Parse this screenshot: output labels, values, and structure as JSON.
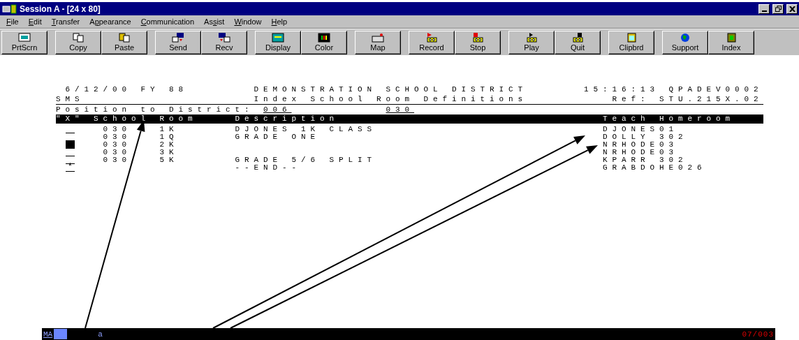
{
  "window": {
    "title": "Session A - [24 x 80]"
  },
  "menu": [
    {
      "key": "F",
      "post": "ile"
    },
    {
      "key": "E",
      "post": "dit"
    },
    {
      "key": "T",
      "post": "ransfer"
    },
    {
      "pre": "A",
      "key": "p",
      "post": "pearance"
    },
    {
      "key": "C",
      "post": "ommunication"
    },
    {
      "pre": "As",
      "key": "s",
      "post": "ist"
    },
    {
      "key": "W",
      "post": "indow"
    },
    {
      "key": "H",
      "post": "elp"
    }
  ],
  "toolbar": [
    [
      {
        "label": "PrtScrn",
        "kind": "printscreen"
      }
    ],
    [
      {
        "label": "Copy",
        "kind": "copy"
      },
      {
        "label": "Paste",
        "kind": "paste"
      }
    ],
    [
      {
        "label": "Send",
        "kind": "send"
      },
      {
        "label": "Recv",
        "kind": "receive"
      }
    ],
    [
      {
        "label": "Display",
        "kind": "display"
      },
      {
        "label": "Color",
        "kind": "color"
      }
    ],
    [
      {
        "label": "Map",
        "kind": "map"
      }
    ],
    [
      {
        "label": "Record",
        "kind": "record"
      },
      {
        "label": "Stop",
        "kind": "stop"
      }
    ],
    [
      {
        "label": "Play",
        "kind": "play"
      },
      {
        "label": "Quit",
        "kind": "quit"
      }
    ],
    [
      {
        "label": "Clipbrd",
        "kind": "clipboard"
      }
    ],
    [
      {
        "label": "Support",
        "kind": "globe"
      },
      {
        "label": "Index",
        "kind": "book"
      }
    ]
  ],
  "terminal": {
    "header": {
      "date": "6/12/00",
      "fiscal_year": "FY 88",
      "title": "DEMONSTRATION SCHOOL DISTRICT",
      "time_and_device": "15:16:13 QPADEV0002",
      "system": "SMS",
      "screen_title": "Index School Room Definitions",
      "reference": "Ref: STU.215X.02"
    },
    "position": {
      "label": "Position to District:",
      "district": "006",
      "school": "030"
    },
    "columns": [
      "\"X\"",
      "School",
      "Room",
      "Description",
      "Teach",
      "Homeroom"
    ],
    "rows": [
      {
        "cursor": false,
        "school": "030",
        "room": "1K",
        "description": "DJONES 1K CLASS",
        "teacher": "DJONES01"
      },
      {
        "cursor": false,
        "school": "030",
        "room": "1Q",
        "description": "GRADE ONE",
        "teacher": "DOLLY 302"
      },
      {
        "cursor": true,
        "school": "030",
        "room": "2K",
        "teacher": "NRHODE03"
      },
      {
        "cursor": false,
        "school": "030",
        "room": "3K",
        "teacher": "NRHODE03"
      },
      {
        "cursor": false,
        "school": "030",
        "room": "5K",
        "description": "GRADE 5/6 SPLIT",
        "teacher": "KPARR 302"
      },
      {
        "cursor": false,
        "marker": "*",
        "description": "--END--",
        "teacher": "GRABDOHE026"
      }
    ]
  },
  "status_bar": {
    "mode": "MA",
    "input": "a",
    "cursor_position": "07/003"
  }
}
